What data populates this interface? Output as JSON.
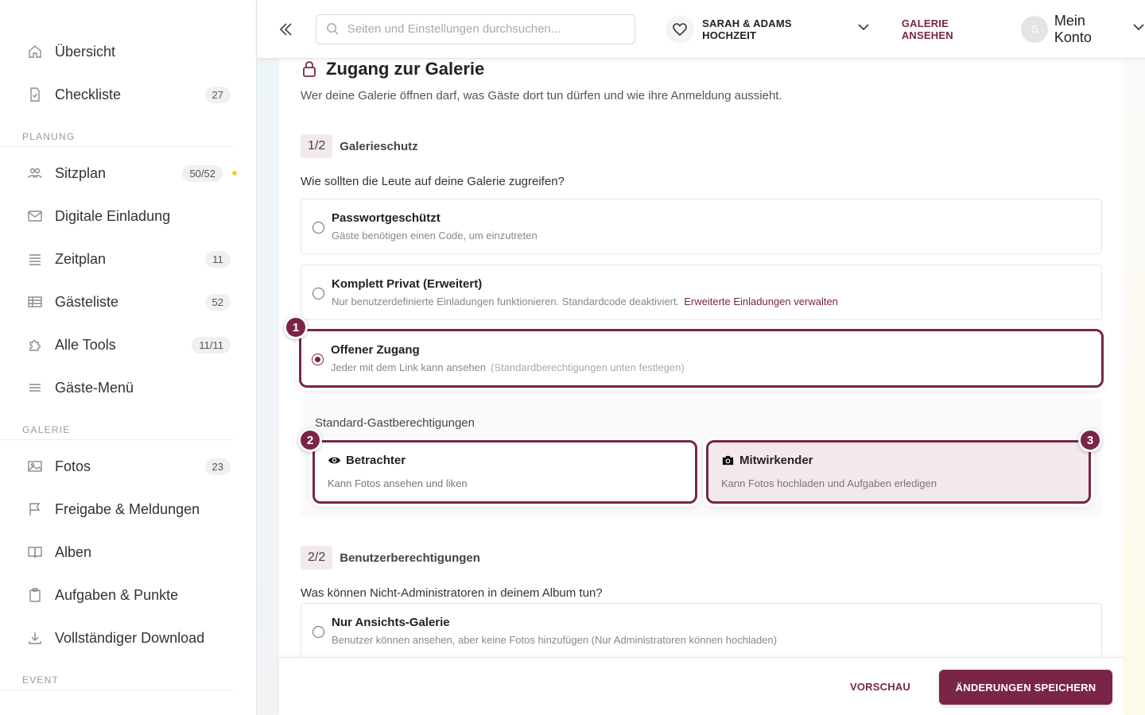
{
  "sidebar": {
    "top_items": [
      {
        "label": "Übersicht",
        "icon": "home-icon"
      },
      {
        "label": "Checkliste",
        "icon": "checklist-icon",
        "badge": "27"
      }
    ],
    "sections": [
      {
        "label": "PLANUNG",
        "items": [
          {
            "label": "Sitzplan",
            "icon": "users-icon",
            "badge": "50/52",
            "dot_color": "#f4d03f"
          },
          {
            "label": "Digitale Einladung",
            "icon": "mail-icon"
          },
          {
            "label": "Zeitplan",
            "icon": "list-icon",
            "badge": "11"
          },
          {
            "label": "Gästeliste",
            "icon": "table-icon",
            "badge": "52"
          },
          {
            "label": "Alle Tools",
            "icon": "puzzle-icon",
            "badge": "11/11"
          },
          {
            "label": "Gäste-Menü",
            "icon": "menu-icon"
          }
        ]
      },
      {
        "label": "GALERIE",
        "items": [
          {
            "label": "Fotos",
            "icon": "image-icon",
            "badge": "23"
          },
          {
            "label": "Freigabe & Meldungen",
            "icon": "flag-icon"
          },
          {
            "label": "Alben",
            "icon": "book-icon"
          },
          {
            "label": "Aufgaben & Punkte",
            "icon": "clipboard-icon"
          },
          {
            "label": "Vollständiger Download",
            "icon": "download-icon"
          }
        ]
      },
      {
        "label": "EVENT",
        "items": []
      }
    ]
  },
  "topbar": {
    "search_placeholder": "Seiten und Einstellungen durchsuchen...",
    "event_name": "SARAH & ADAMS HOCHZEIT",
    "gallery_link": "GALERIE ANSEHEN",
    "avatar_initial": "S",
    "account_label": "Mein Konto"
  },
  "main": {
    "title": "Zugang zur Galerie",
    "subtitle": "Wer deine Galerie öffnen darf, was Gäste dort tun dürfen und wie ihre Anmeldung aussieht.",
    "step1": {
      "num": "1/2",
      "label": "Galerieschutz"
    },
    "question1": "Wie sollten die Leute auf deine Galerie zugreifen?",
    "access_options": [
      {
        "title": "Passwortgeschützt",
        "desc": "Gäste benötigen einen Code, um einzutreten",
        "selected": false
      },
      {
        "title": "Komplett Privat (Erweitert)",
        "desc": "Nur benutzerdefinierte Einladungen funktionieren. Standardcode deaktiviert.",
        "link": "Erweiterte Einladungen verwalten",
        "selected": false
      },
      {
        "title": "Offener Zugang",
        "desc": "Jeder mit dem Link kann ansehen",
        "hint": "(Standardberechtigungen unten festlegen)",
        "selected": true
      }
    ],
    "default_perms": {
      "title": "Standard-Gastberechtigungen",
      "cards": [
        {
          "title": "Betrachter",
          "icon": "eye-icon",
          "desc": "Kann Fotos ansehen und liken",
          "selected": false
        },
        {
          "title": "Mitwirkender",
          "icon": "camera-icon",
          "desc": "Kann Fotos hochladen und Aufgaben erledigen",
          "selected": true
        }
      ]
    },
    "markers": [
      "1",
      "2",
      "3"
    ],
    "step2": {
      "num": "2/2",
      "label": "Benutzerberechtigungen"
    },
    "question2": "Was können Nicht-Administratoren in deinem Album tun?",
    "user_options": [
      {
        "title": "Nur Ansichts-Galerie",
        "desc": "Benutzer können ansehen, aber keine Fotos hinzufügen (Nur Administratoren können hochladen)",
        "selected": false
      }
    ]
  },
  "footer": {
    "preview_label": "VORSCHAU",
    "save_label": "ÄNDERUNGEN SPEICHERN"
  },
  "colors": {
    "accent": "#7a2548",
    "accent_light": "#f3e8ec",
    "status_dot": "#f4d03f"
  }
}
